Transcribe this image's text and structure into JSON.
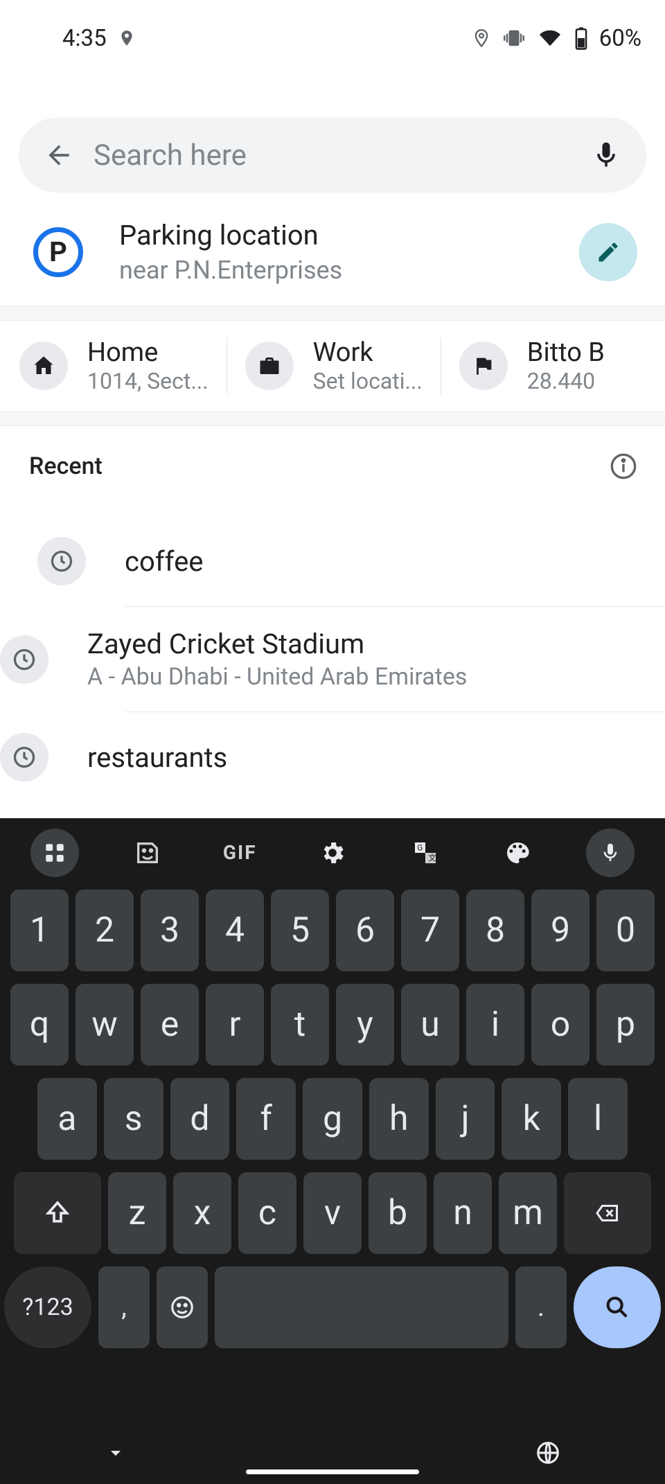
{
  "status": {
    "time": "4:35",
    "battery": "60%"
  },
  "search": {
    "placeholder": "Search here"
  },
  "parking": {
    "title": "Parking location",
    "subtitle": "near P.N.Enterprises",
    "icon_letter": "P"
  },
  "shortcuts": [
    {
      "title": "Home",
      "subtitle": "1014, Sect..."
    },
    {
      "title": "Work",
      "subtitle": "Set locati..."
    },
    {
      "title": "Bitto B",
      "subtitle": "28.440"
    }
  ],
  "recent": {
    "label": "Recent",
    "items": [
      {
        "line1": "coffee",
        "line2": ""
      },
      {
        "line1": "Zayed Cricket Stadium",
        "line2": "A - Abu Dhabi - United Arab Emirates"
      },
      {
        "line1": "restaurants",
        "line2": ""
      }
    ]
  },
  "keyboard": {
    "toolbar_gif": "GIF",
    "row_num": [
      "1",
      "2",
      "3",
      "4",
      "5",
      "6",
      "7",
      "8",
      "9",
      "0"
    ],
    "row1": [
      "q",
      "w",
      "e",
      "r",
      "t",
      "y",
      "u",
      "i",
      "o",
      "p"
    ],
    "row2": [
      "a",
      "s",
      "d",
      "f",
      "g",
      "h",
      "j",
      "k",
      "l"
    ],
    "row3": [
      "z",
      "x",
      "c",
      "v",
      "b",
      "n",
      "m"
    ],
    "symbols": "?123",
    "comma": ",",
    "period": "."
  }
}
